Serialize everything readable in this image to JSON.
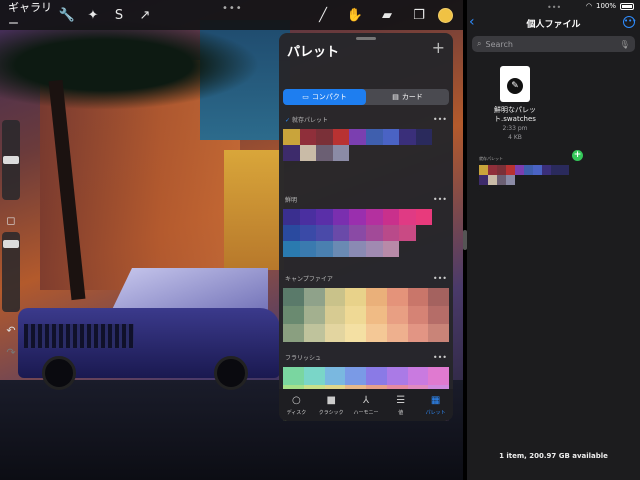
{
  "toolbar": {
    "gallery_label": "ギャラリー",
    "icons": [
      "wrench-icon",
      "magic-wand-icon",
      "selection-icon",
      "transform-arrow-icon"
    ],
    "right_icons": [
      "brush-icon",
      "smudge-icon",
      "eraser-icon",
      "layers-icon"
    ],
    "color": "#f0c244"
  },
  "palette_panel": {
    "title": "パレット",
    "add_label": "+",
    "segments": [
      "コンパクト",
      "カード"
    ],
    "sections": [
      {
        "name": "就存パレット",
        "rows": [
          [
            "#c9a43b",
            "#8f2f3a",
            "#7a3038",
            "#b83232",
            "#7b3fb0",
            "#3f5fae",
            "#4a63c4",
            "#3a2f7a",
            "#2a2a5c"
          ],
          [
            "#3d2b6b",
            "#c9bba7",
            "#6b5f73",
            "#8b8ba6"
          ]
        ]
      },
      {
        "name": "鮮明",
        "bars": [
          [
            "#3a2f8f",
            "#4a2fa0",
            "#5a2fa8",
            "#7a2faf",
            "#9a2fae",
            "#b4309f",
            "#c9308c",
            "#e03a84",
            "#e83a7c"
          ],
          [
            "#2a4a9f",
            "#3a4aa7",
            "#4a4aa9",
            "#6a4aa9",
            "#8a4aa5",
            "#a24a98",
            "#b94a8a",
            "#c94a84"
          ],
          [
            "#2a7aaf",
            "#3a7aaf",
            "#4a80b0",
            "#6a8ab3",
            "#8a8ab3",
            "#a08ab1",
            "#b88aa8"
          ]
        ]
      },
      {
        "name": "キャンプファイア",
        "grid": [
          [
            "#5a7a6a",
            "#8fa28a",
            "#c9c28a",
            "#e8d28a",
            "#eab07a",
            "#e4937a",
            "#c9766a",
            "#a4625f"
          ],
          [
            "#6a8a70",
            "#a3b08f",
            "#d7cb92",
            "#efd995",
            "#f0bb85",
            "#e89f83",
            "#d58375",
            "#b56d68"
          ],
          [
            "#8a9f80",
            "#bfc39c",
            "#e3d5a0",
            "#f4e0a3",
            "#f4c896",
            "#eeb08e",
            "#e29584",
            "#c98478"
          ]
        ]
      },
      {
        "name": "フラリッシュ",
        "grid": [
          [
            "#7ad6a0",
            "#7ad6c8",
            "#7ab8e0",
            "#7a9ae6",
            "#8a7ae6",
            "#aa7ae6",
            "#c97ae0",
            "#e07ad0"
          ],
          [
            "#a6e08a",
            "#c9e08a",
            "#e0d68a",
            "#e6b88a",
            "#e6a08a",
            "#e68aa0",
            "#e08ac0",
            "#d08ae0"
          ],
          [
            "#c8e87a",
            "#e8e87a",
            "#f0c87a",
            "#f0a87a",
            "#f0907a",
            "#f07a98",
            "#e87ab8",
            "#d07ae0"
          ]
        ]
      }
    ],
    "tabs": [
      {
        "label": "ディスク",
        "icon": "disc-icon"
      },
      {
        "label": "クラシック",
        "icon": "square-icon"
      },
      {
        "label": "ハーモニー",
        "icon": "harmony-icon"
      },
      {
        "label": "値",
        "icon": "sliders-icon"
      },
      {
        "label": "パレット",
        "icon": "grid-icon"
      }
    ]
  },
  "files": {
    "status_battery": "100%",
    "title": "個人ファイル",
    "search_placeholder": "Search",
    "item": {
      "name_line1": "鮮明なパレッ",
      "name_line2": "ト.swatches",
      "time": "2:33 pm",
      "size": "4 KB"
    },
    "drag_label": "就存パレット",
    "drag_swatches": [
      "#c9a43b",
      "#8f2f3a",
      "#7a3038",
      "#b83232",
      "#7b3fb0",
      "#3f5fae",
      "#4a63c4",
      "#3a2f7a",
      "#2a2a5c",
      "#2a2a5c",
      "#3d2b6b",
      "#c9bba7",
      "#6b5f73",
      "#8b8ba6"
    ],
    "storage": "1 item, 200.97 GB available",
    "accent": "#2f8dff"
  }
}
